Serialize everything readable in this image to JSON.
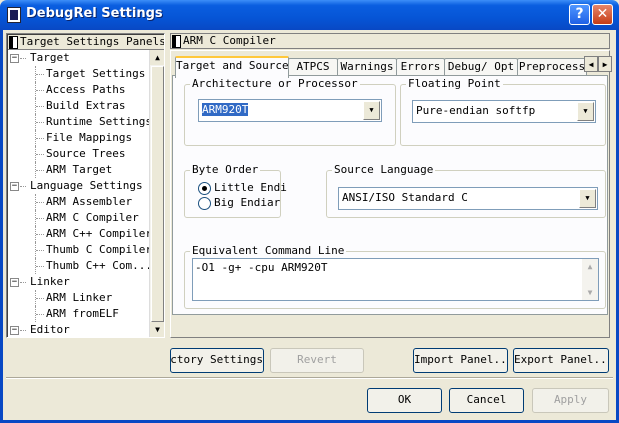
{
  "window": {
    "title": "DebugRel Settings",
    "help_glyph": "?",
    "close_glyph": "✕"
  },
  "left_panel": {
    "header": "Target Settings Panels",
    "tree": [
      {
        "label": "Target",
        "level": 0,
        "expand": "−"
      },
      {
        "label": "Target Settings",
        "level": 1
      },
      {
        "label": "Access Paths",
        "level": 1
      },
      {
        "label": "Build Extras",
        "level": 1
      },
      {
        "label": "Runtime Settings",
        "level": 1
      },
      {
        "label": "File Mappings",
        "level": 1
      },
      {
        "label": "Source Trees",
        "level": 1
      },
      {
        "label": "ARM Target",
        "level": 1
      },
      {
        "label": "Language Settings",
        "level": 0,
        "expand": "−"
      },
      {
        "label": "ARM Assembler",
        "level": 1
      },
      {
        "label": "ARM C Compiler",
        "level": 1
      },
      {
        "label": "ARM C++ Compiler",
        "level": 1
      },
      {
        "label": "Thumb C Compiler",
        "level": 1
      },
      {
        "label": "Thumb C++ Com...",
        "level": 1
      },
      {
        "label": "Linker",
        "level": 0,
        "expand": "−"
      },
      {
        "label": "ARM Linker",
        "level": 1
      },
      {
        "label": "ARM fromELF",
        "level": 1
      },
      {
        "label": "Editor",
        "level": 0,
        "expand": "−"
      }
    ]
  },
  "right_panel": {
    "header": "ARM C Compiler",
    "tabs": [
      "Target and Source",
      "ATPCS",
      "Warnings",
      "Errors",
      "Debug/ Opt",
      "Preprocess"
    ],
    "active_tab": "Target and Source",
    "architecture": {
      "label": "Architecture or Processor",
      "value": "ARM920T"
    },
    "floating_point": {
      "label": "Floating Point",
      "value": "Pure-endian softfp"
    },
    "byte_order": {
      "label": "Byte Order",
      "options": [
        "Little Endi",
        "Big Endiar"
      ],
      "selected": "Little Endi"
    },
    "source_language": {
      "label": "Source Language",
      "value": "ANSI/ISO Standard C"
    },
    "command_line": {
      "label": "Equivalent Command Line",
      "value": "-O1 -g+ -cpu ARM920T"
    }
  },
  "panel_buttons": {
    "factory": "Factory Settings",
    "revert": "Revert",
    "import": "Import Panel...",
    "export": "Export Panel..."
  },
  "dialog_buttons": {
    "ok": "OK",
    "cancel": "Cancel",
    "apply": "Apply"
  }
}
